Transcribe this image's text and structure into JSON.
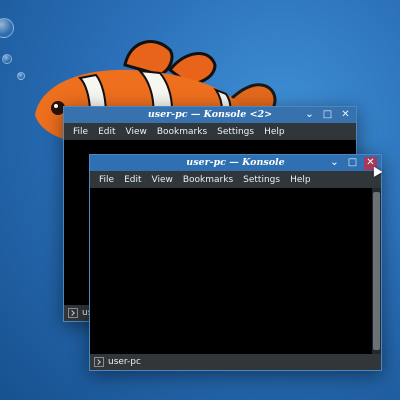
{
  "desktop": {
    "wallpaper": "clownfish-underwater"
  },
  "window_back": {
    "title": "user-pc — Konsole <2>",
    "menu": [
      "File",
      "Edit",
      "View",
      "Bookmarks",
      "Settings",
      "Help"
    ],
    "tab_label": "user-pc"
  },
  "window_front": {
    "title": "user-pc — Konsole",
    "menu": [
      "File",
      "Edit",
      "View",
      "Bookmarks",
      "Settings",
      "Help"
    ],
    "tab_label": "user-pc"
  },
  "buttons": {
    "minimize": "⌄",
    "maximize": "□",
    "close": "✕"
  },
  "colors": {
    "accent": "#2f70b2",
    "close_hover": "#a8375a",
    "terminal_bg": "#000000"
  }
}
